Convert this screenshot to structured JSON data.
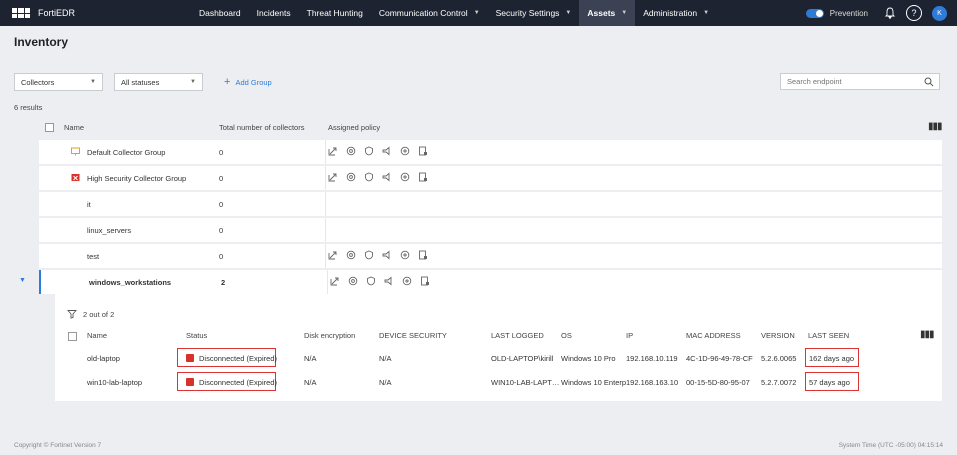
{
  "app": {
    "brand": "FortiEDR"
  },
  "nav": {
    "items": [
      {
        "label": "Dashboard"
      },
      {
        "label": "Incidents"
      },
      {
        "label": "Threat Hunting"
      },
      {
        "label": "Communication Control"
      },
      {
        "label": "Security Settings"
      },
      {
        "label": "Assets"
      },
      {
        "label": "Administration"
      }
    ],
    "prevention_label": "Prevention",
    "help_label": "?",
    "avatar_label": "K"
  },
  "page": {
    "title": "Inventory",
    "results": "6 results",
    "filters": {
      "type_value": "Collectors",
      "status_value": "All statuses",
      "add_group": "Add Group",
      "search_placeholder": "Search endpoint"
    }
  },
  "groups_table": {
    "headers": {
      "name": "Name",
      "total": "Total number of collectors",
      "policy": "Assigned policy"
    },
    "rows": [
      {
        "name": "Default Collector Group",
        "count": "0",
        "icon": "monitor-icon",
        "has_policy": true
      },
      {
        "name": "High Security Collector Group",
        "count": "0",
        "icon": "high-security-icon",
        "has_policy": true
      },
      {
        "name": "it",
        "count": "0",
        "icon": "",
        "has_policy": false
      },
      {
        "name": "linux_servers",
        "count": "0",
        "icon": "",
        "has_policy": false
      },
      {
        "name": "test",
        "count": "0",
        "icon": "",
        "has_policy": true
      },
      {
        "name": "windows_workstations",
        "count": "2",
        "icon": "",
        "has_policy": true
      }
    ]
  },
  "collectors": {
    "filter_text": "2 out of 2",
    "headers": {
      "name": "Name",
      "status": "Status",
      "disk": "Disk encryption",
      "device": "DEVICE SECURITY",
      "logged": "LAST LOGGED",
      "os": "OS",
      "ip": "IP",
      "mac": "MAC ADDRESS",
      "version": "VERSION",
      "seen": "LAST SEEN"
    },
    "rows": [
      {
        "name": "old-laptop",
        "status": "Disconnected (Expired)",
        "disk": "N/A",
        "device": "N/A",
        "logged": "OLD-LAPTOP\\kirill",
        "os": "Windows 10 Pro",
        "ip": "192.168.10.119",
        "mac": "4C-1D-96-49-78-CF",
        "version": "5.2.6.0065",
        "seen": "162 days ago"
      },
      {
        "name": "win10-lab-laptop",
        "status": "Disconnected (Expired)",
        "disk": "N/A",
        "device": "N/A",
        "logged": "WIN10-LAB-LAPT…",
        "os": "Windows 10 Enterp",
        "ip": "192.168.163.10",
        "mac": "00-15-5D-80-95-07",
        "version": "5.2.7.0072",
        "seen": "57 days ago"
      }
    ]
  },
  "footer": {
    "copyright": "Copyright © Fortinet Version 7",
    "system_time": "System Time (UTC -05:00) 04:15:14"
  },
  "colors": {
    "topbar": "#1d2330",
    "accent": "#2f7cd8",
    "status_red": "#d9312a",
    "highlight_box": "#dd3333"
  }
}
